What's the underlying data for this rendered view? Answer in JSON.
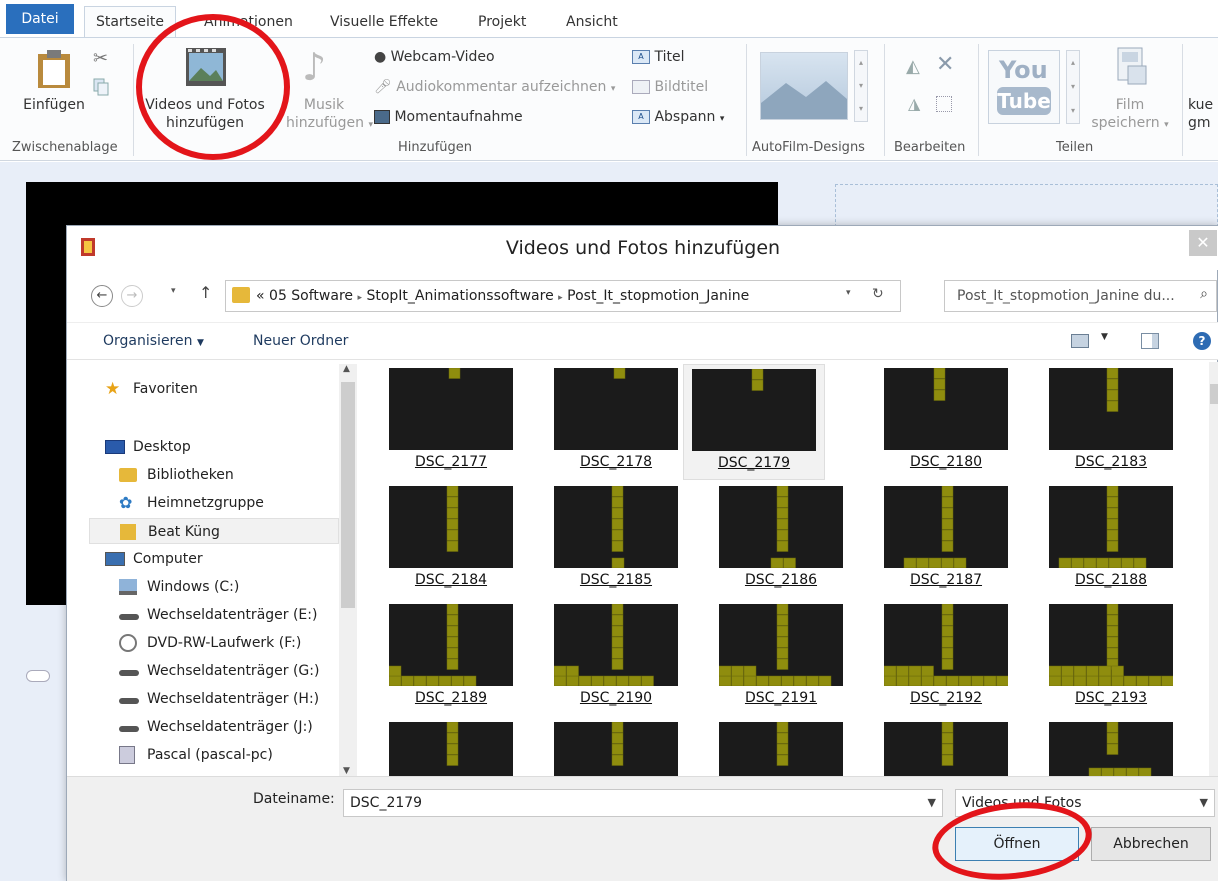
{
  "tabs": [
    {
      "label": "Datei"
    },
    {
      "label": "Startseite"
    },
    {
      "label": "Animationen"
    },
    {
      "label": "Visuelle Effekte"
    },
    {
      "label": "Projekt"
    },
    {
      "label": "Ansicht"
    }
  ],
  "ribbon": {
    "einfuegen": "Einfügen",
    "videos_fotos_line1": "Videos und Fotos",
    "videos_fotos_line2": "hinzufügen",
    "musik_line1": "Musik",
    "musik_line2": "hinzufügen",
    "webcam": "Webcam-Video",
    "audiokommentar": "Audiokommentar aufzeichnen",
    "momentaufnahme": "Momentaufnahme",
    "titel": "Titel",
    "bildtitel": "Bildtitel",
    "abspann": "Abspann",
    "youtube_top": "You",
    "youtube_bottom": "Tube",
    "film_line1": "Film",
    "film_line2": "speichern",
    "cut_text_line1": "kue",
    "cut_text_line2": "gm",
    "groups": {
      "zwischenablage": "Zwischenablage",
      "hinzufuegen": "Hinzufügen",
      "autofilm": "AutoFilm-Designs",
      "bearbeiten": "Bearbeiten",
      "teilen": "Teilen"
    }
  },
  "dialog": {
    "title": "Videos und Fotos hinzufügen",
    "address": {
      "prefix": "«",
      "segments": [
        "05 Software",
        "StopIt_Animationssoftware",
        "Post_It_stopmotion_Janine"
      ]
    },
    "search_placeholder": "Post_It_stopmotion_Janine du...",
    "toolbar": {
      "organisieren": "Organisieren",
      "neuer_ordner": "Neuer Ordner"
    },
    "nav_items": [
      {
        "label": "Favoriten",
        "icon": "star-icon"
      },
      {
        "label": "Desktop",
        "icon": "desktop-icon"
      },
      {
        "label": "Bibliotheken",
        "icon": "libraries-icon"
      },
      {
        "label": "Heimnetzgruppe",
        "icon": "homegroup-icon"
      },
      {
        "label": "Beat Küng",
        "icon": "user-folder-icon"
      },
      {
        "label": "Computer",
        "icon": "computer-icon"
      },
      {
        "label": "Windows (C:)",
        "icon": "windows-drive-icon"
      },
      {
        "label": "Wechseldatenträger (E:)",
        "icon": "removable-drive-icon"
      },
      {
        "label": "DVD-RW-Laufwerk (F:)",
        "icon": "dvd-drive-icon"
      },
      {
        "label": "Wechseldatenträger (G:)",
        "icon": "removable-drive-icon"
      },
      {
        "label": "Wechseldatenträger (H:)",
        "icon": "removable-drive-icon"
      },
      {
        "label": "Wechseldatenträger (J:)",
        "icon": "removable-drive-icon"
      },
      {
        "label": "Pascal (pascal-pc)",
        "icon": "network-pc-icon"
      }
    ],
    "files": [
      {
        "name": "DSC_2177"
      },
      {
        "name": "DSC_2178"
      },
      {
        "name": "DSC_2179",
        "selected": true
      },
      {
        "name": "DSC_2180"
      },
      {
        "name": "DSC_2183"
      },
      {
        "name": "DSC_2184"
      },
      {
        "name": "DSC_2185"
      },
      {
        "name": "DSC_2186"
      },
      {
        "name": "DSC_2187"
      },
      {
        "name": "DSC_2188"
      },
      {
        "name": "DSC_2189"
      },
      {
        "name": "DSC_2190"
      },
      {
        "name": "DSC_2191"
      },
      {
        "name": "DSC_2192"
      },
      {
        "name": "DSC_2193"
      },
      {
        "name": ""
      },
      {
        "name": ""
      },
      {
        "name": ""
      },
      {
        "name": ""
      },
      {
        "name": ""
      }
    ],
    "filename_label": "Dateiname:",
    "filename_value": "DSC_2179",
    "filetype_value": "Videos und Fotos",
    "open_label": "Öffnen",
    "cancel_label": "Abbrechen"
  },
  "colors": {
    "accent": "#2a6fbd",
    "annotation_red": "#e3151a",
    "postit_yellow": "#8f8d0e"
  }
}
